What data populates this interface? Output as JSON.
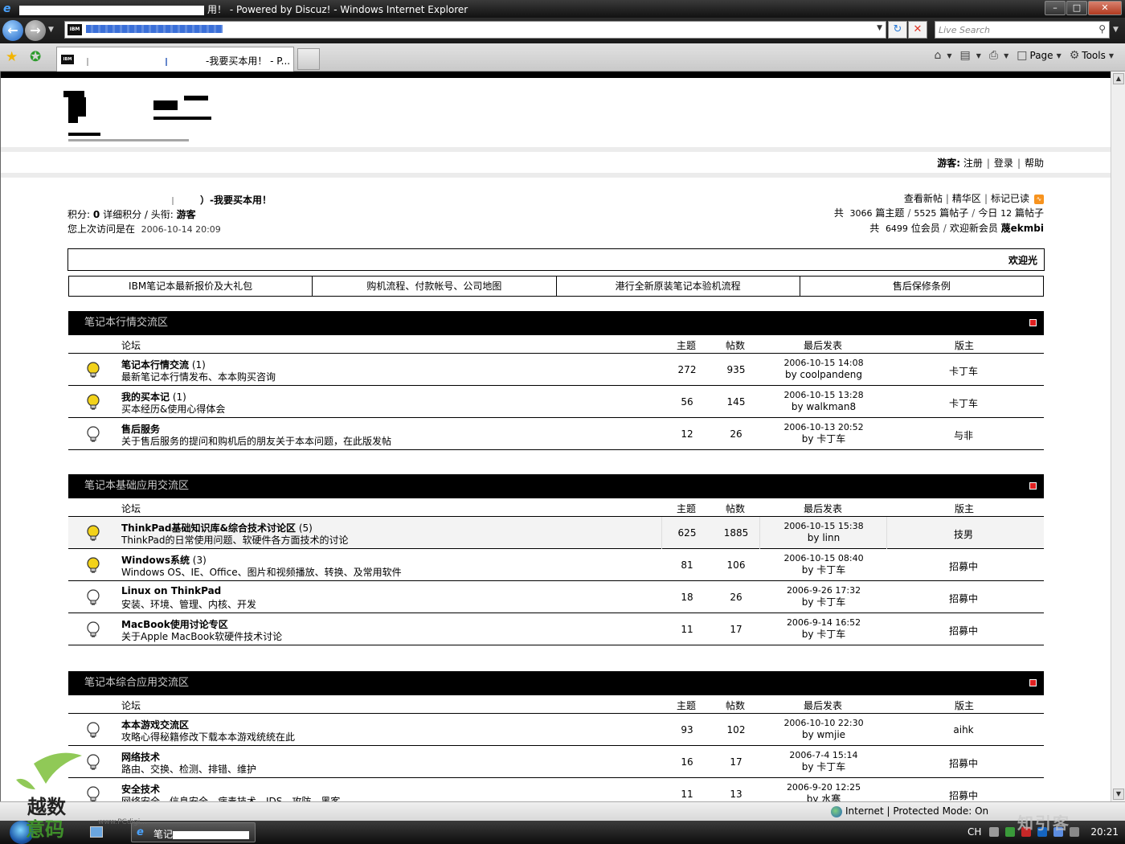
{
  "window": {
    "title": "用！ - Powered by Discuz! - Windows Internet Explorer",
    "controls": [
      "–",
      "□",
      "✕"
    ]
  },
  "address": {
    "favicon": "IBM",
    "search_placeholder": "Live Search"
  },
  "tab": {
    "favicon": "IBM",
    "label": "-我要买本用！ - P..."
  },
  "command_bar": {
    "page": "Page",
    "tools": "Tools"
  },
  "header": {
    "guest_label": "游客:",
    "links": [
      "注册",
      "登录",
      "帮助"
    ]
  },
  "user": {
    "forum_name_suffix": "）-我要买本用！",
    "points_label": "积分:",
    "points_value": "0",
    "points_detail": "详细积分 / 头衔:",
    "rank": "游客",
    "last_visit_label": "您上次访问是在",
    "last_visit": "2006-10-14 20:09"
  },
  "stats": {
    "links": [
      "查看新帖",
      "精华区",
      "标记已读"
    ],
    "line2_prefix": "共",
    "threads": "3066",
    "threads_label": "篇主题",
    "posts": "5525",
    "posts_label": "篇帖子",
    "today_label": "今日",
    "today": "12",
    "today_suffix": "篇帖子",
    "members": "6499",
    "members_label": "位会员",
    "welcome_new": "欢迎新会员",
    "newest_member": "蔑ekmbi"
  },
  "welcome_text": "欢迎光",
  "quick_links": [
    "IBM笔记本最新报价及大礼包",
    "购机流程、付款帐号、公司地图",
    "港行全新原装笔记本验机流程",
    "售后保修条例"
  ],
  "columns": {
    "forum": "论坛",
    "topics": "主题",
    "posts": "帖数",
    "last": "最后发表",
    "mod": "版主"
  },
  "sections": [
    {
      "title": "笔记本行情交流区",
      "forums": [
        {
          "name": "笔记本行情交流",
          "count": "(1)",
          "desc": "最新笔记本行情发布、本本购买咨询",
          "topics": "272",
          "posts": "935",
          "last_time": "2006-10-15 14:08",
          "last_by": "by coolpandeng",
          "mod": "卡丁车",
          "new": true
        },
        {
          "name": "我的买本记",
          "count": "(1)",
          "desc": "买本经历&使用心得体会",
          "topics": "56",
          "posts": "145",
          "last_time": "2006-10-15 13:28",
          "last_by": "by walkman8",
          "mod": "卡丁车",
          "new": true
        },
        {
          "name": "售后服务",
          "count": "",
          "desc": "关于售后服务的提问和购机后的朋友关于本本问题，在此版发帖",
          "topics": "12",
          "posts": "26",
          "last_time": "2006-10-13 20:52",
          "last_by": "by 卡丁车",
          "mod": "与非",
          "new": false
        }
      ]
    },
    {
      "title": "笔记本基础应用交流区",
      "forums": [
        {
          "name": "ThinkPad基础知识库&综合技术讨论区",
          "count": "(5)",
          "desc": "ThinkPad的日常使用问题、软硬件各方面技术的讨论",
          "topics": "625",
          "posts": "1885",
          "last_time": "2006-10-15 15:38",
          "last_by": "by linn",
          "mod": "技男",
          "new": true,
          "hl": true
        },
        {
          "name": "Windows系统",
          "count": "(3)",
          "desc": "Windows OS、IE、Office、图片和视频播放、转换、及常用软件",
          "topics": "81",
          "posts": "106",
          "last_time": "2006-10-15 08:40",
          "last_by": "by 卡丁车",
          "mod": "招募中",
          "new": true
        },
        {
          "name": "Linux on ThinkPad",
          "count": "",
          "desc": "安装、环境、管理、内核、开发",
          "topics": "18",
          "posts": "26",
          "last_time": "2006-9-26 17:32",
          "last_by": "by 卡丁车",
          "mod": "招募中",
          "new": false
        },
        {
          "name": "MacBook使用讨论专区",
          "count": "",
          "desc": "关于Apple MacBook软硬件技术讨论",
          "topics": "11",
          "posts": "17",
          "last_time": "2006-9-14 16:52",
          "last_by": "by 卡丁车",
          "mod": "招募中",
          "new": false
        }
      ]
    },
    {
      "title": "笔记本综合应用交流区",
      "forums": [
        {
          "name": "本本游戏交流区",
          "count": "",
          "desc": "攻略心得秘籍修改下载本本游戏统统在此",
          "topics": "93",
          "posts": "102",
          "last_time": "2006-10-10 22:30",
          "last_by": "by wmjie",
          "mod": "aihk",
          "new": false
        },
        {
          "name": "网络技术",
          "count": "",
          "desc": "路由、交换、检测、排错、维护",
          "topics": "16",
          "posts": "17",
          "last_time": "2006-7-4 15:14",
          "last_by": "by 卡丁车",
          "mod": "招募中",
          "new": false
        },
        {
          "name": "安全技术",
          "count": "",
          "desc": "网络安全、信息安全、病毒技术、IDS、攻防、黑客",
          "topics": "11",
          "posts": "13",
          "last_time": "2006-9-20 12:25",
          "last_by": "by 水寨",
          "mod": "招募中",
          "new": false
        }
      ]
    }
  ],
  "status": {
    "zone": "Internet | Protected Mode: On"
  },
  "taskbar": {
    "task_prefix": "笔记",
    "lang": "CH",
    "clock": "20:21"
  },
  "watermark": {
    "left_top": "越数",
    "left_bottom": "意码",
    "left_url": "www.PCdigi...",
    "right": "知引客"
  },
  "colors": {
    "section_header": "#000000",
    "collapse": "#e02020",
    "bulb_on": "#f2d21a",
    "bulb_off": "#ffffff"
  }
}
